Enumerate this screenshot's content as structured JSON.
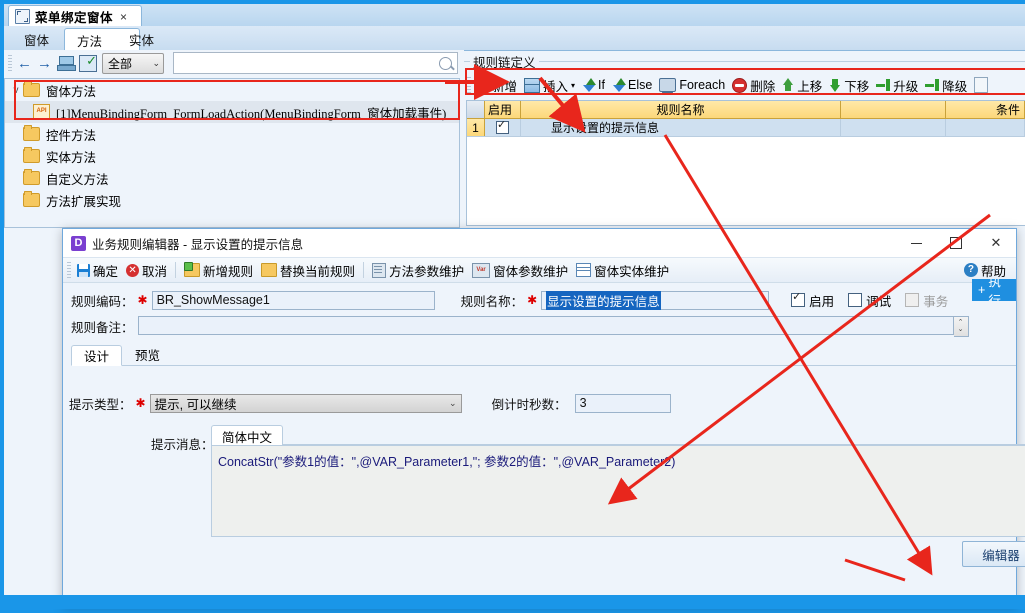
{
  "window": {
    "doc_tab": {
      "label": "菜单绑定窗体",
      "close": "×",
      "icon": "form-icon"
    },
    "sub_tabs": [
      {
        "label": "窗体",
        "selected": false
      },
      {
        "label": "方法",
        "selected": true
      },
      {
        "label": "实体",
        "selected": false
      }
    ]
  },
  "left_toolbar": {
    "back": "←",
    "forward": "→",
    "network_icon": "network-icon",
    "check_icon": "checklist-icon",
    "filter_value": "全部",
    "search_value": "",
    "search_placeholder": ""
  },
  "tree": {
    "items": [
      {
        "label": "窗体方法",
        "icon": "folder-icon",
        "expander": "v",
        "level": 0,
        "highlighted": true
      },
      {
        "label": "[1]MenuBindingForm_FormLoadAction(MenuBindingForm_窗体加载事件)",
        "icon": "api-icon",
        "level": 1,
        "selected": true,
        "mono": true
      },
      {
        "label": "控件方法",
        "icon": "folder-icon",
        "level": 0
      },
      {
        "label": "实体方法",
        "icon": "folder-icon",
        "level": 0
      },
      {
        "label": "自定义方法",
        "icon": "folder-icon",
        "level": 0
      },
      {
        "label": "方法扩展实现",
        "icon": "folder-icon",
        "level": 0
      }
    ]
  },
  "rules_panel": {
    "group_title": "规则链定义",
    "toolbar": [
      {
        "label": "新增",
        "icon": "plus-icon"
      },
      {
        "label": "插入",
        "icon": "insert-icon",
        "dropdown": "▾"
      },
      {
        "label": "If",
        "icon": "if-icon"
      },
      {
        "label": "Else",
        "icon": "else-icon"
      },
      {
        "label": "Foreach",
        "icon": "foreach-icon"
      },
      {
        "label": "删除",
        "icon": "delete-icon"
      },
      {
        "label": "上移",
        "icon": "move-up-icon"
      },
      {
        "label": "下移",
        "icon": "move-down-icon"
      },
      {
        "label": "升级",
        "icon": "promote-icon"
      },
      {
        "label": "降级",
        "icon": "demote-icon"
      },
      {
        "label": "",
        "icon": "copy-icon"
      }
    ],
    "grid": {
      "columns": [
        "",
        "启用",
        "规则名称",
        "",
        "条件"
      ],
      "rows": [
        {
          "num": "1",
          "enabled": true,
          "name": "显示设置的提示信息",
          "blank": "",
          "condition": ""
        }
      ]
    }
  },
  "dialog": {
    "title": "业务规则编辑器 - 显示设置的提示信息",
    "logo": "D",
    "window_buttons": {
      "minimize": "—",
      "maximize": "▢",
      "close": "✕"
    },
    "toolbar": [
      {
        "label": "确定",
        "icon": "save-icon"
      },
      {
        "label": "取消",
        "icon": "cancel-icon"
      },
      {
        "label": "新增规则",
        "icon": "add-rule-icon"
      },
      {
        "label": "替换当前规则",
        "icon": "replace-rule-icon"
      },
      {
        "label": "方法参数维护",
        "icon": "method-param-icon"
      },
      {
        "label": "窗体参数维护",
        "icon": "form-param-icon"
      },
      {
        "label": "窗体实体维护",
        "icon": "form-entity-icon"
      }
    ],
    "help_label": "帮助",
    "fields": {
      "rule_code_label": "规则编码：",
      "rule_code_value": "BR_ShowMessage1",
      "rule_name_label": "规则名称：",
      "rule_name_value": "显示设置的提示信息",
      "rule_remark_label": "规则备注：",
      "rule_remark_value": ""
    },
    "checkboxes": [
      {
        "label": "启用",
        "checked": true,
        "disabled": false
      },
      {
        "label": "调试",
        "checked": false,
        "disabled": false
      },
      {
        "label": "事务",
        "checked": false,
        "disabled": true
      }
    ],
    "exec_button": "执行",
    "tabs": [
      {
        "label": "设计",
        "selected": true
      },
      {
        "label": "预览",
        "selected": false
      }
    ],
    "design": {
      "tip_type_label": "提示类型：",
      "tip_type_value": "提示, 可以继续",
      "countdown_label": "倒计时秒数：",
      "countdown_value": "3",
      "message_label": "提示消息：",
      "message_tab": "简体中文",
      "message_value": "ConcatStr(\"参数1的值：\",@VAR_Parameter1,\"; 参数2的值：\",@VAR_Parameter2)",
      "editor_button": "编辑器"
    }
  },
  "colors": {
    "frame_blue": "#1a96e8",
    "grid_header": "#fcd87a",
    "row_blue": "#cfe0f0",
    "accent_red": "#e8261c",
    "selection_blue": "#1565c0",
    "exec_blue": "#1f8fe0"
  }
}
